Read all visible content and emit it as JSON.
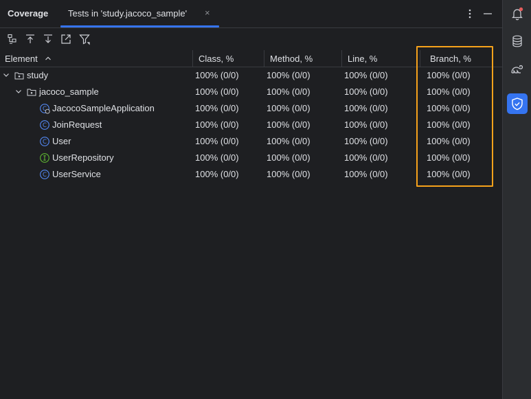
{
  "header": {
    "tool_title": "Coverage",
    "tab_label": "Tests in 'study.jacoco_sample'",
    "tab_close": "×"
  },
  "toolbar": {
    "icons": [
      "flatten-packages-icon",
      "navigate-up-icon",
      "navigate-down-icon",
      "open-in-editor-icon",
      "filter-icon"
    ]
  },
  "table": {
    "columns": {
      "element": "Element",
      "class": "Class, %",
      "method": "Method, %",
      "line": "Line, %",
      "branch": "Branch, %"
    },
    "rows": [
      {
        "name": "study",
        "kind": "package",
        "expanded": true,
        "class": "100% (0/0)",
        "method": "100% (0/0)",
        "line": "100% (0/0)",
        "branch": "100% (0/0)"
      },
      {
        "name": "jacoco_sample",
        "kind": "package",
        "expanded": true,
        "class": "100% (0/0)",
        "method": "100% (0/0)",
        "line": "100% (0/0)",
        "branch": "100% (0/0)"
      },
      {
        "name": "JacocoSampleApplication",
        "kind": "spring-class",
        "class": "100% (0/0)",
        "method": "100% (0/0)",
        "line": "100% (0/0)",
        "branch": "100% (0/0)"
      },
      {
        "name": "JoinRequest",
        "kind": "class",
        "class": "100% (0/0)",
        "method": "100% (0/0)",
        "line": "100% (0/0)",
        "branch": "100% (0/0)"
      },
      {
        "name": "User",
        "kind": "class",
        "class": "100% (0/0)",
        "method": "100% (0/0)",
        "line": "100% (0/0)",
        "branch": "100% (0/0)"
      },
      {
        "name": "UserRepository",
        "kind": "interface",
        "class": "100% (0/0)",
        "method": "100% (0/0)",
        "line": "100% (0/0)",
        "branch": "100% (0/0)"
      },
      {
        "name": "UserService",
        "kind": "class",
        "class": "100% (0/0)",
        "method": "100% (0/0)",
        "line": "100% (0/0)",
        "branch": "100% (0/0)"
      }
    ]
  },
  "right_bar": {
    "icons": [
      "notifications-icon",
      "database-icon",
      "gradle-icon",
      "coverage-icon"
    ],
    "active": "coverage-icon"
  },
  "colors": {
    "accent": "#3574f0",
    "highlight_border": "#f7a21b",
    "class_icon": "#548af7",
    "interface_icon": "#5fb832"
  }
}
